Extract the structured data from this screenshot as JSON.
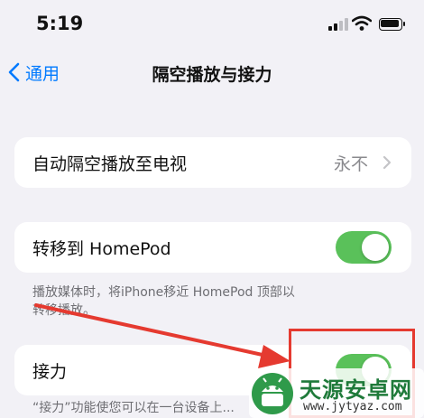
{
  "status_bar": {
    "time": "5:19",
    "icons": [
      "cellular-signal-icon",
      "wifi-icon",
      "battery-icon"
    ]
  },
  "nav": {
    "back_label": "通用",
    "title": "隔空播放与接力"
  },
  "airplay_tv": {
    "label": "自动隔空播放至电视",
    "value": "永不"
  },
  "homepod": {
    "label": "转移到 HomePod",
    "toggle_on": true,
    "footnote_line1": "播放媒体时，将iPhone移近 HomePod 顶部以",
    "footnote_line2": "转移播放。"
  },
  "handoff": {
    "label": "接力",
    "toggle_on": true,
    "footnote": "“接力”功能使您可以在一台设备上..."
  },
  "annotation": {
    "color": "#e53a30"
  },
  "watermark": {
    "name": "天源安卓网",
    "url": "www.jytyaz.com"
  },
  "colors": {
    "accent": "#007aff",
    "toggle_on": "#5ac15a",
    "background": "#f2f1f6"
  }
}
